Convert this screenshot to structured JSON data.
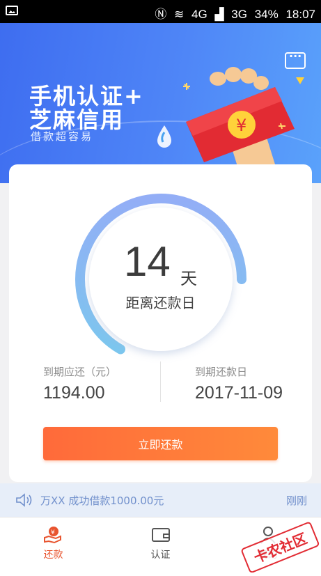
{
  "status_bar": {
    "network1": "4G",
    "network2": "3G",
    "battery": "34%",
    "time": "18:07"
  },
  "banner": {
    "title_line1": "手机认证+",
    "title_line2": "芝麻信用",
    "subtitle": "借款超容易"
  },
  "countdown": {
    "days": "14",
    "unit": "天",
    "caption": "距离还款日",
    "progress": 0.8
  },
  "due": {
    "amount_label": "到期应还（元）",
    "amount_value": "1194.00",
    "date_label": "到期还款日",
    "date_value": "2017-11-09"
  },
  "pay_button": "立即还款",
  "ticker": {
    "message": "万XX 成功借款1000.00元",
    "time": "刚刚"
  },
  "tabs": [
    {
      "label": "还款",
      "icon": "repay-icon",
      "active": true
    },
    {
      "label": "认证",
      "icon": "wallet-icon",
      "active": false
    },
    {
      "label": "我的",
      "icon": "user-icon",
      "active": false
    }
  ],
  "watermark": "卡农社区",
  "colors": {
    "accent": "#ff6a3a",
    "banner": "#4f86f7",
    "ticker_text": "#7190cc",
    "active_tab": "#e8542f"
  }
}
